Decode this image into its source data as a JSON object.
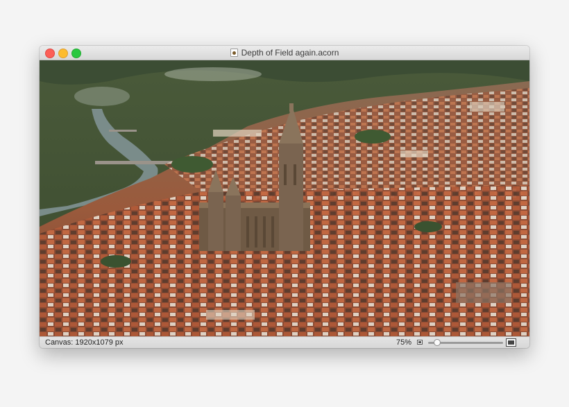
{
  "window": {
    "title": "Depth of Field again.acorn",
    "doc_icon": "acorn-document-icon"
  },
  "canvas": {
    "description_icon": "photo-image"
  },
  "statusbar": {
    "canvas_size": "Canvas: 1920x1079 px",
    "zoom": "75%",
    "zoom_fraction": 0.08
  },
  "colors": {
    "close": "#fc5f57",
    "minimize": "#fdbc2e",
    "zoom": "#28c840"
  }
}
